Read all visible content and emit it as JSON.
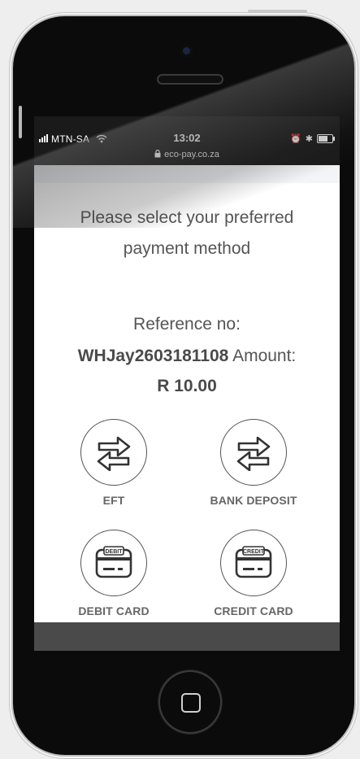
{
  "status_bar": {
    "carrier": "MTN-SA",
    "wifi_icon": "wifi-icon",
    "time": "13:02",
    "url": "eco-pay.co.za",
    "lock_icon": "lock-icon"
  },
  "page": {
    "instructions": "Please select your preferred payment method",
    "reference_label": "Reference no:",
    "reference_value": "WHJay2603181108",
    "amount_label": "Amount:",
    "amount_value": "R 10.00"
  },
  "payment_options": [
    {
      "label": "EFT",
      "icon": "transfer-arrows-icon"
    },
    {
      "label": "BANK DEPOSIT",
      "icon": "transfer-arrows-icon"
    },
    {
      "label": "DEBIT CARD",
      "icon": "debit-card-icon",
      "card_text": "DEBIT"
    },
    {
      "label": "CREDIT CARD",
      "icon": "credit-card-icon",
      "card_text": "CREDIT"
    }
  ],
  "colors": {
    "phone_body": "#0b0b0b",
    "screen_bg": "#ffffff",
    "text_gray": "#555555",
    "bottom_bar": "#4a4a4a"
  }
}
